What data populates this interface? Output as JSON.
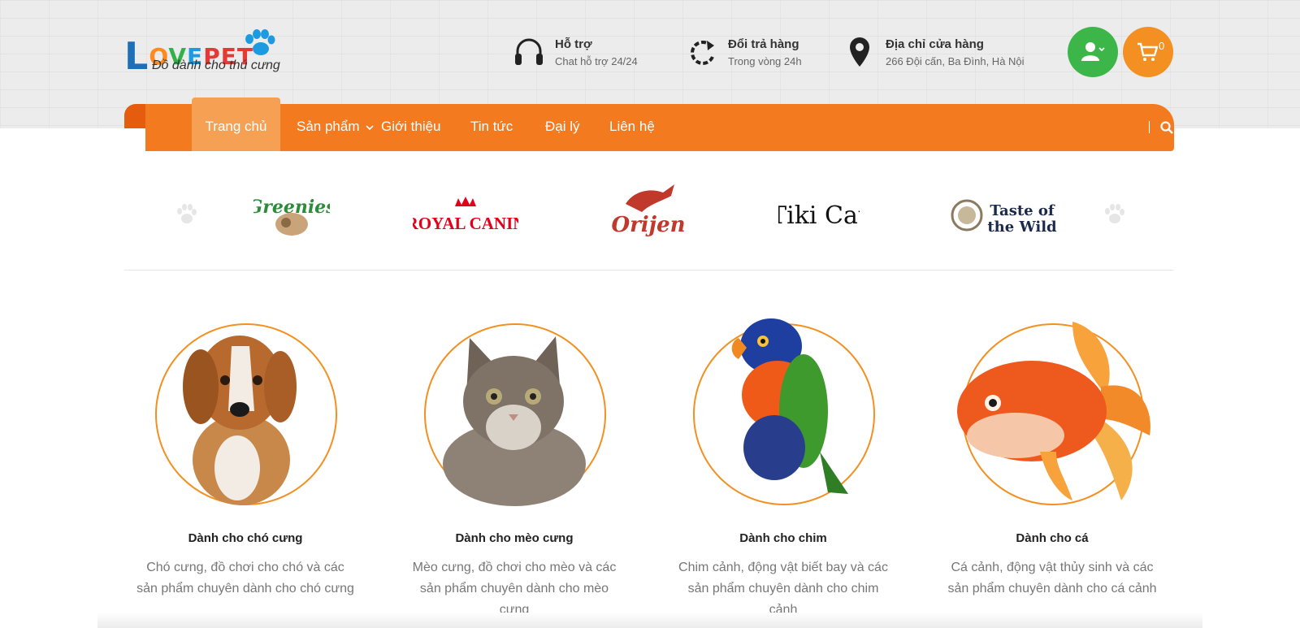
{
  "logo": {
    "word_first": "L",
    "word_o": "O",
    "word_v": "V",
    "word_e": "E",
    "word_pet": "PET",
    "tagline": "Đồ dành cho thú cưng"
  },
  "header_info": [
    {
      "icon": "headset-icon",
      "title": "Hỗ trợ",
      "subtitle": "Chat hỗ trợ 24/24"
    },
    {
      "icon": "return-icon",
      "title": "Đổi trả hàng",
      "subtitle": "Trong vòng 24h"
    },
    {
      "icon": "map-pin-icon",
      "title": "Địa chỉ cửa hàng",
      "subtitle": "266 Đội cấn, Ba Đình, Hà Nội"
    }
  ],
  "cart": {
    "count": "0"
  },
  "nav": {
    "items": [
      "Trang chủ",
      "Sản phẩm",
      "Giới thiệu",
      "Tin tức",
      "Đại lý",
      "Liên hệ"
    ],
    "active": "Trang chủ"
  },
  "brands": [
    "Greenies",
    "ROYAL CANIN",
    "Orijen",
    "Tiki Cat",
    "Taste of the Wild"
  ],
  "categories": [
    {
      "title": "Dành cho chó cưng",
      "desc": "Chó cưng, đồ chơi cho chó và các sản phẩm chuyên dành cho chó cưng"
    },
    {
      "title": "Dành cho mèo cưng",
      "desc": "Mèo cưng, đồ chơi cho mèo và các sản phẩm chuyên dành cho mèo cưng"
    },
    {
      "title": "Dành cho chim",
      "desc": "Chim cảnh, động vật biết bay và các sản phẩm chuyên dành cho chim cảnh"
    },
    {
      "title": "Dành cho cá",
      "desc": "Cá cảnh, động vật thủy sinh và các sản phẩm chuyên dành cho cá cảnh"
    }
  ],
  "colors": {
    "accent": "#f47a20",
    "green": "#3cb648",
    "orange_btn": "#f39021"
  }
}
